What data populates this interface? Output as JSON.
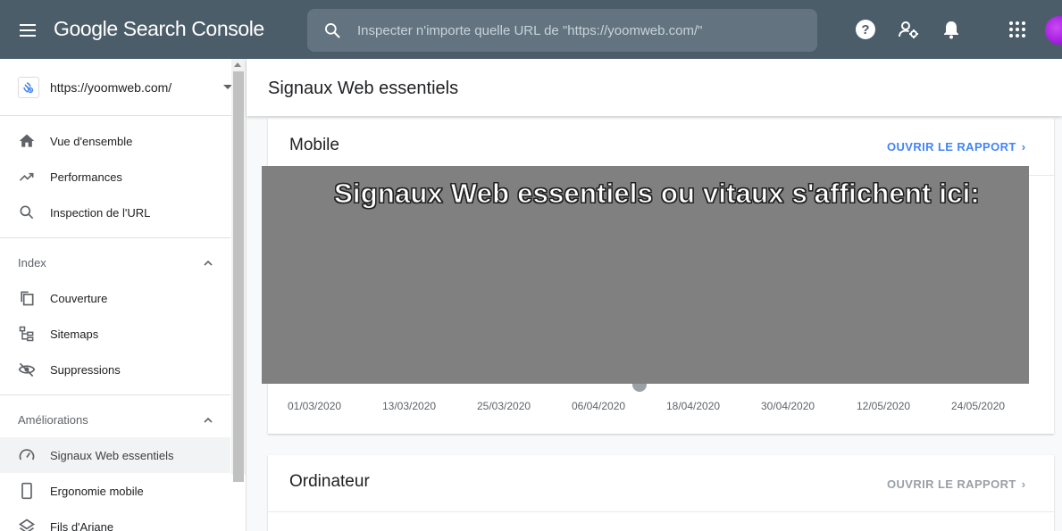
{
  "app": {
    "title": "Google Search Console"
  },
  "search": {
    "placeholder": "Inspecter n'importe quelle URL de \"https://yoomweb.com/\""
  },
  "property": {
    "url": "https://yoomweb.com/"
  },
  "sidebar": {
    "items": [
      {
        "label": "Vue d'ensemble",
        "icon": "home-icon"
      },
      {
        "label": "Performances",
        "icon": "trending-up-icon"
      },
      {
        "label": "Inspection de l'URL",
        "icon": "search-icon"
      }
    ],
    "index": {
      "title": "Index",
      "items": [
        {
          "label": "Couverture",
          "icon": "copy-icon"
        },
        {
          "label": "Sitemaps",
          "icon": "sitemap-icon"
        },
        {
          "label": "Suppressions",
          "icon": "visibility-off-icon"
        }
      ]
    },
    "ameliorations": {
      "title": "Améliorations",
      "items": [
        {
          "label": "Signaux Web essentiels",
          "icon": "speed-icon",
          "active": true
        },
        {
          "label": "Ergonomie mobile",
          "icon": "smartphone-icon"
        },
        {
          "label": "Fils d'Ariane",
          "icon": "layers-icon"
        }
      ]
    }
  },
  "page": {
    "title": "Signaux Web essentiels"
  },
  "mobile": {
    "title": "Mobile",
    "link": "OUVRIR LE RAPPORT",
    "overlay": "Signaux Web essentiels ou vitaux s'affichent  ici:",
    "x_dates": [
      "01/03/2020",
      "13/03/2020",
      "25/03/2020",
      "06/04/2020",
      "18/04/2020",
      "30/04/2020",
      "12/05/2020",
      "24/05/2020"
    ]
  },
  "desktop": {
    "title": "Ordinateur",
    "link": "OUVRIR LE RAPPORT"
  },
  "colors": {
    "topbar": "#4c5d6a",
    "link_active": "#4285f4",
    "link_disabled": "#9aa0a6"
  }
}
